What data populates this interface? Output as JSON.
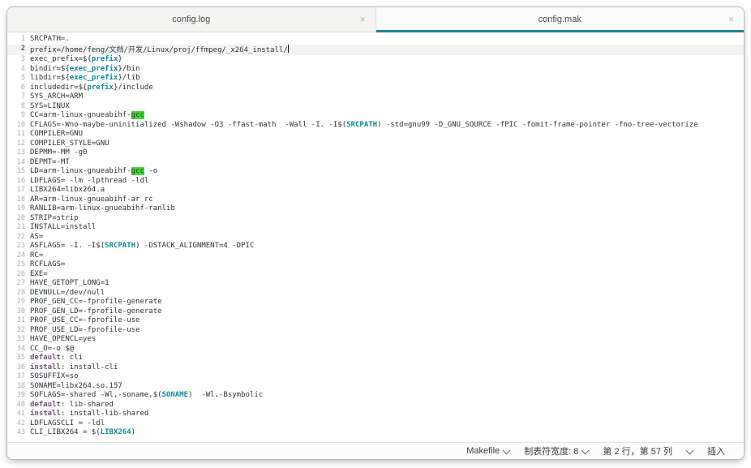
{
  "colors": {
    "accent": "#217f9e",
    "text": "#2e3436",
    "variable": "#0f8b99",
    "keyword": "#75507b",
    "match_bg": "#49d539"
  },
  "tabs": [
    {
      "label": "config.log",
      "active": false,
      "close_glyph": "×"
    },
    {
      "label": "config.mak",
      "active": true,
      "close_glyph": "×"
    }
  ],
  "editor": {
    "cursor_line": 2,
    "lines": [
      {
        "n": 1,
        "s": [
          [
            "SRCPATH=.",
            "t"
          ]
        ]
      },
      {
        "n": 2,
        "s": [
          [
            "prefix=/home/feng/文档/开发/Linux/proj/ffmpeg/_x264_install/",
            "t"
          ]
        ]
      },
      {
        "n": 3,
        "s": [
          [
            "exec_prefix=${",
            "t"
          ],
          [
            "prefix",
            "v"
          ],
          [
            "}",
            "t"
          ]
        ]
      },
      {
        "n": 4,
        "s": [
          [
            "bindir=${",
            "t"
          ],
          [
            "exec_prefix",
            "v"
          ],
          [
            "}/bin",
            "t"
          ]
        ]
      },
      {
        "n": 5,
        "s": [
          [
            "libdir=${",
            "t"
          ],
          [
            "exec_prefix",
            "v"
          ],
          [
            "}/lib",
            "t"
          ]
        ]
      },
      {
        "n": 6,
        "s": [
          [
            "includedir=${",
            "t"
          ],
          [
            "prefix",
            "v"
          ],
          [
            "}/include",
            "t"
          ]
        ]
      },
      {
        "n": 7,
        "s": [
          [
            "SYS_ARCH=ARM",
            "t"
          ]
        ]
      },
      {
        "n": 8,
        "s": [
          [
            "SYS=LINUX",
            "t"
          ]
        ]
      },
      {
        "n": 9,
        "s": [
          [
            "CC=arm-linux-gnueabihf-",
            "t"
          ],
          [
            "gcc",
            "m"
          ]
        ]
      },
      {
        "n": 10,
        "s": [
          [
            "CFLAGS=-Wno-maybe-uninitialized -Wshadow -O3 -ffast-math  -Wall -I. -I$(",
            "t"
          ],
          [
            "SRCPATH",
            "v"
          ],
          [
            ") -std=gnu99 -D_GNU_SOURCE -fPIC -fomit-frame-pointer -fno-tree-vectorize",
            "t"
          ]
        ]
      },
      {
        "n": 11,
        "s": [
          [
            "COMPILER=GNU",
            "t"
          ]
        ]
      },
      {
        "n": 12,
        "s": [
          [
            "COMPILER_STYLE=GNU",
            "t"
          ]
        ]
      },
      {
        "n": 13,
        "s": [
          [
            "DEPMM=-MM -g0",
            "t"
          ]
        ]
      },
      {
        "n": 14,
        "s": [
          [
            "DEPMT=-MT",
            "t"
          ]
        ]
      },
      {
        "n": 15,
        "s": [
          [
            "LD=arm-linux-gnueabihf-",
            "t"
          ],
          [
            "gcc",
            "m"
          ],
          [
            " -o",
            "t"
          ]
        ]
      },
      {
        "n": 16,
        "s": [
          [
            "LDFLAGS= -lm -lpthread -ldl",
            "t"
          ]
        ]
      },
      {
        "n": 17,
        "s": [
          [
            "LIBX264=libx264.a",
            "t"
          ]
        ]
      },
      {
        "n": 18,
        "s": [
          [
            "AR=arm-linux-gnueabihf-ar rc",
            "t"
          ]
        ]
      },
      {
        "n": 19,
        "s": [
          [
            "RANLIB=arm-linux-gnueabihf-ranlib",
            "t"
          ]
        ]
      },
      {
        "n": 20,
        "s": [
          [
            "STRIP=strip",
            "t"
          ]
        ]
      },
      {
        "n": 21,
        "s": [
          [
            "INSTALL=install",
            "t"
          ]
        ]
      },
      {
        "n": 22,
        "s": [
          [
            "AS=",
            "t"
          ]
        ]
      },
      {
        "n": 23,
        "s": [
          [
            "ASFLAGS= -I. -I$(",
            "t"
          ],
          [
            "SRCPATH",
            "v"
          ],
          [
            ") -DSTACK_ALIGNMENT=4 -DPIC",
            "t"
          ]
        ]
      },
      {
        "n": 24,
        "s": [
          [
            "RC=",
            "t"
          ]
        ]
      },
      {
        "n": 25,
        "s": [
          [
            "RCFLAGS=",
            "t"
          ]
        ]
      },
      {
        "n": 26,
        "s": [
          [
            "EXE=",
            "t"
          ]
        ]
      },
      {
        "n": 27,
        "s": [
          [
            "HAVE_GETOPT_LONG=1",
            "t"
          ]
        ]
      },
      {
        "n": 28,
        "s": [
          [
            "DEVNULL=/dev/null",
            "t"
          ]
        ]
      },
      {
        "n": 29,
        "s": [
          [
            "PROF_GEN_CC=-fprofile-generate",
            "t"
          ]
        ]
      },
      {
        "n": 30,
        "s": [
          [
            "PROF_GEN_LD=-fprofile-generate",
            "t"
          ]
        ]
      },
      {
        "n": 31,
        "s": [
          [
            "PROF_USE_CC=-fprofile-use",
            "t"
          ]
        ]
      },
      {
        "n": 32,
        "s": [
          [
            "PROF_USE_LD=-fprofile-use",
            "t"
          ]
        ]
      },
      {
        "n": 33,
        "s": [
          [
            "HAVE_OPENCL=yes",
            "t"
          ]
        ]
      },
      {
        "n": 34,
        "s": [
          [
            "CC_O=-o $@",
            "t"
          ]
        ]
      },
      {
        "n": 35,
        "s": [
          [
            "default",
            "k"
          ],
          [
            ": cli",
            "t"
          ]
        ]
      },
      {
        "n": 36,
        "s": [
          [
            "install",
            "k"
          ],
          [
            ": install-cli",
            "t"
          ]
        ]
      },
      {
        "n": 37,
        "s": [
          [
            "SOSUFFIX=so",
            "t"
          ]
        ]
      },
      {
        "n": 38,
        "s": [
          [
            "SONAME=libx264.so.157",
            "t"
          ]
        ]
      },
      {
        "n": 39,
        "s": [
          [
            "SOFLAGS=-shared -Wl,-soname,$(",
            "t"
          ],
          [
            "SONAME",
            "v"
          ],
          [
            ")  -Wl,-Bsymbolic",
            "t"
          ]
        ]
      },
      {
        "n": 40,
        "s": [
          [
            "default",
            "k"
          ],
          [
            ": lib-shared",
            "t"
          ]
        ]
      },
      {
        "n": 41,
        "s": [
          [
            "install",
            "k"
          ],
          [
            ": install-lib-shared",
            "t"
          ]
        ]
      },
      {
        "n": 42,
        "s": [
          [
            "LDFLAGSCLI = -ldl",
            "t"
          ]
        ]
      },
      {
        "n": 43,
        "s": [
          [
            "CLI_LIBX264 = $(",
            "t"
          ],
          [
            "LIBX264",
            "v"
          ],
          [
            ")",
            "t"
          ]
        ]
      }
    ]
  },
  "statusbar": {
    "language": "Makefile",
    "tab_width_label": "制表符宽度: 8",
    "position": "第 2 行，第 57 列",
    "insert_mode": "插入"
  }
}
